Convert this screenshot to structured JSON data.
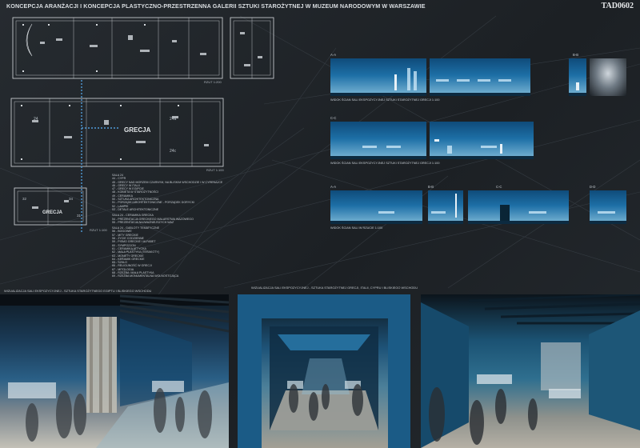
{
  "board": {
    "title": "KONCEPCJA ARANŻACJI I KONCEPCJA PLASTYCZNO-PRZESTRZENNA GALERII SZTUKI STAROŻYTNEJ W MUZEUM NARODOWYM W WARSZAWIE",
    "code": "TAD0602"
  },
  "plans": {
    "top_scale": "RZUT 1:200",
    "middle_scale": "RZUT 1:100",
    "bottom_scale": "RZUT 1:100",
    "room_main": "GRECJA",
    "room_small": "GRECJA",
    "room_numbers": [
      "24",
      "24a",
      "24c",
      "31",
      "32",
      "34"
    ]
  },
  "legend": {
    "heading_1": "SALA 24",
    "items_1": [
      "44 - CYPR",
      "45 - GRECY NAD MORZEM CZARNYM, NA BLISKIM WSCHODZIE I W CYRENAJCE",
      "46 - GRECY W ITALII",
      "47 - GRECY W EGIPCIE",
      "48 - KOBIETA W STAROŻYTNOŚCI",
      "49 - CERAMIKA",
      "50 - SZTUKA ARCHITEKTONICZNA",
      "51 - PORZĄDKI ARCHITEKTONICZNE - PORZĄDEK DORYCKI",
      "52 - LAMPKI",
      "53 - DETALE ARCHITEKTONICZNE"
    ],
    "heading_2": "SALA 24 - CERAMIKA GRECKA",
    "items_2": [
      "54 - PREZENTACJA GRECKIEGO MALARSTWA WAZOWEGO",
      "55 - PREZENTACJA NAJWAŻNIEJSZYCH WAZ"
    ],
    "heading_3": "SALA 24 - GABLOTY TEMATYCZNE",
    "items_3": [
      "56 - BOGOWIE",
      "57 - MITY GRECKIE",
      "58 - ŻYCIE CODZIENNE",
      "59 - PISMO GRECKIE I ALFABET",
      "60 - SYMPOZJON",
      "61 - CERAMIKA ATTYCKA",
      "62 - MAŁA PLASTYKA (TERAKOTY)",
      "63 - MONETY GRECKIE",
      "64 - KERAMIK GRECKIE",
      "65 - SZKŁO",
      "66 - RELIGIJNOŚĆ W GRECJI",
      "67 - MITOLOGIA",
      "68 - RZEŹBA: MAŁA PLASTYKA",
      "69 - RZEŹBA MONUMENTALNA WOLNOSTOJĄCA"
    ]
  },
  "elevations": {
    "aa_label": "A-A",
    "aa_caption": "WIDOK ŚCIAN SALI EKSPOZYCYJNEJ SZTUKI STAROŻYTNEJ GRECJI 1:100",
    "bb_label": "B-B",
    "cc_label": "C-C",
    "cc_caption": "WIDOK ŚCIAN SALI EKSPOZYCYJNEJ SZTUKI STAROŻYTNEJ GRECJI 1:100",
    "row3_labels": [
      "A-A",
      "B-B",
      "C-C",
      "D-D"
    ],
    "row3_caption": "WIDOK ŚCIAN SALI W RZUCIE 1:100"
  },
  "renders": {
    "caption_left": "WIZUALIZACJA SALI EKSPOZYCYJNEJ - SZTUKA STAROŻYTNEGO EGIPTU I BLISKIEGO WSCHODU",
    "caption_mid": "WIZUALIZACJA SALI EKSPOZYCYJNEJ - SZTUKA STAROŻYTNEJ GRECJI, ITALII, CYPRU I BLISKIEGO WSCHODU"
  },
  "colors": {
    "background": "#1f2327",
    "wall_blue": "#1d6fa6",
    "plan_line": "#d7dbdf",
    "route": "#4f9bd8"
  }
}
